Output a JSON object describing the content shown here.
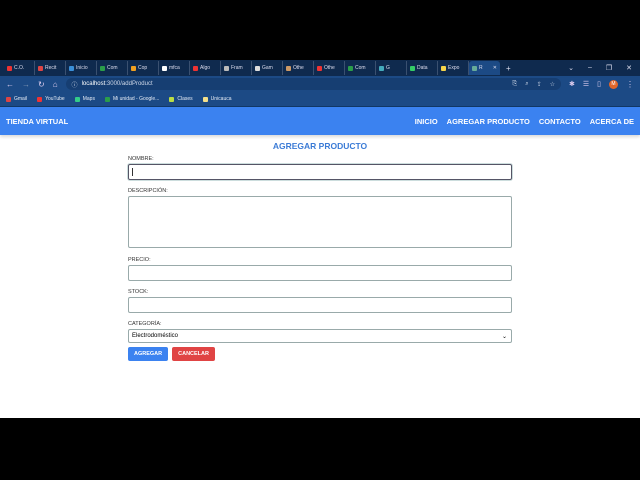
{
  "browser": {
    "tabs": [
      {
        "title": "C.O.",
        "color": "#e33"
      },
      {
        "title": "Recit",
        "color": "#d44"
      },
      {
        "title": "Inicio",
        "color": "#3a8fd8"
      },
      {
        "title": "Com",
        "color": "#2a9d4a"
      },
      {
        "title": "Cop",
        "color": "#f0a020"
      },
      {
        "title": "mfca",
        "color": "#fff"
      },
      {
        "title": "Algo",
        "color": "#e33"
      },
      {
        "title": "Fram",
        "color": "#bbb"
      },
      {
        "title": "Gam",
        "color": "#ddd"
      },
      {
        "title": "Othe",
        "color": "#c96"
      },
      {
        "title": "Othe",
        "color": "#e33"
      },
      {
        "title": "Com",
        "color": "#2a9d4a"
      },
      {
        "title": "G",
        "color": "#4ab"
      },
      {
        "title": "Data",
        "color": "#3c6"
      },
      {
        "title": "Expo",
        "color": "#f5d44a"
      },
      {
        "title": "R",
        "color": "#6a9",
        "active": true
      }
    ],
    "new_tab": "+",
    "window_controls": [
      "⌄",
      "–",
      "❐",
      "✕"
    ],
    "url_host": "localhost",
    "url_path": ":3000/addProduct",
    "profile_initial": "M",
    "bookmarks": [
      {
        "label": "Gmail",
        "color": "#d44"
      },
      {
        "label": "YouTube",
        "color": "#e33"
      },
      {
        "label": "Maps",
        "color": "#3c8"
      },
      {
        "label": "Mi unidad - Google...",
        "color": "#2a9d4a"
      },
      {
        "label": "Clases",
        "color": "#bd4"
      },
      {
        "label": "Unicauca",
        "color": "#f5e08a"
      }
    ]
  },
  "app": {
    "brand": "TIENDA VIRTUAL",
    "nav": [
      "INICIO",
      "AGREGAR PRODUCTO",
      "CONTACTO",
      "ACERCA DE"
    ],
    "page_title": "AGREGAR PRODUCTO",
    "form": {
      "name_label": "NOMBRE:",
      "name_value": "",
      "desc_label": "DESCRIPCIÓN:",
      "desc_value": "",
      "price_label": "PRECIO:",
      "price_value": "",
      "stock_label": "STOCK:",
      "stock_value": "",
      "category_label": "CATEGORÍA:",
      "category_value": "Electrodoméstico",
      "submit": "AGREGAR",
      "cancel": "CANCELAR"
    },
    "colors": {
      "primary": "#3b82f0",
      "danger": "#e04444"
    }
  }
}
